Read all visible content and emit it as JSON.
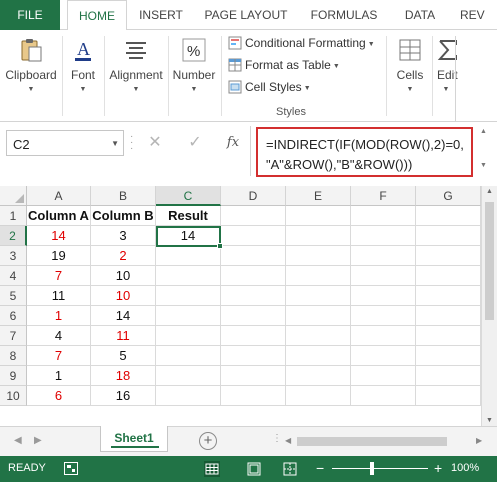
{
  "ribbon": {
    "tabs": [
      "FILE",
      "HOME",
      "INSERT",
      "PAGE LAYOUT",
      "FORMULAS",
      "DATA",
      "REV"
    ],
    "active_tab": "HOME",
    "groups": {
      "clipboard": "Clipboard",
      "font": "Font",
      "alignment": "Alignment",
      "number": "Number",
      "cells": "Cells",
      "editing": "Edit"
    },
    "styles_commands": {
      "conditional_formatting": "Conditional Formatting",
      "format_as_table": "Format as Table",
      "cell_styles": "Cell Styles"
    },
    "styles_group_label": "Styles",
    "font_icon_letter": "A",
    "number_icon_symbol": "%"
  },
  "formula_bar": {
    "name_box": "C2",
    "cancel": "✕",
    "enter": "✓",
    "fx": "fx",
    "formula": "=INDIRECT(IF(MOD(ROW(),2)=0,\n\"A\"&ROW(),\"B\"&ROW()))"
  },
  "sheet": {
    "columns": [
      "A",
      "B",
      "C",
      "D",
      "E",
      "F",
      "G"
    ],
    "rows": [
      "1",
      "2",
      "3",
      "4",
      "5",
      "6",
      "7",
      "8",
      "9",
      "10"
    ],
    "selected_cell": "C2",
    "headers": {
      "A": "Column A",
      "B": "Column B",
      "C": "Result"
    },
    "data": [
      {
        "row": "2",
        "a": "14",
        "a_red": true,
        "b": "3",
        "b_red": false,
        "c": "14"
      },
      {
        "row": "3",
        "a": "19",
        "a_red": false,
        "b": "2",
        "b_red": true,
        "c": ""
      },
      {
        "row": "4",
        "a": "7",
        "a_red": true,
        "b": "10",
        "b_red": false,
        "c": ""
      },
      {
        "row": "5",
        "a": "11",
        "a_red": false,
        "b": "10",
        "b_red": true,
        "c": ""
      },
      {
        "row": "6",
        "a": "1",
        "a_red": true,
        "b": "14",
        "b_red": false,
        "c": ""
      },
      {
        "row": "7",
        "a": "4",
        "a_red": false,
        "b": "11",
        "b_red": true,
        "c": ""
      },
      {
        "row": "8",
        "a": "7",
        "a_red": true,
        "b": "5",
        "b_red": false,
        "c": ""
      },
      {
        "row": "9",
        "a": "1",
        "a_red": false,
        "b": "18",
        "b_red": true,
        "c": ""
      },
      {
        "row": "10",
        "a": "6",
        "a_red": true,
        "b": "16",
        "b_red": false,
        "c": ""
      }
    ],
    "tab_name": "Sheet1",
    "add_sheet_symbol": "⊕"
  },
  "status": {
    "ready": "READY",
    "zoom": "100%",
    "zoom_minus": "−",
    "zoom_plus": "+"
  },
  "colors": {
    "accent": "#217346",
    "red_values": "#e00000",
    "formula_highlight": "#d32f2f"
  }
}
